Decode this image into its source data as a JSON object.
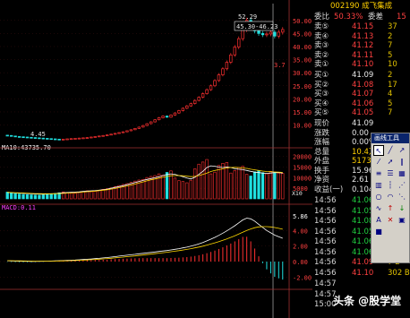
{
  "colors": {
    "up": "#ff3030",
    "down": "#20e0e0",
    "ma5": "#ffffff",
    "ma10": "#ffd700",
    "ma20": "#ff40ff",
    "dif": "#ffffff",
    "dea": "#ffd700"
  },
  "candles_panel": {
    "high_label": "52.29",
    "crosshair_box": "45.30-46.23",
    "low_label": "4.45",
    "cursor_label": "3.7",
    "axis_ticks": [
      "50.00",
      "45.00",
      "40.00",
      "35.00",
      "30.00",
      "25.00",
      "20.00",
      "15.00",
      "10.00"
    ]
  },
  "volume_panel": {
    "title": "MA10:43735.70",
    "axis_ticks": [
      "20000",
      "15000",
      "10000",
      "5000"
    ],
    "unit": "X10"
  },
  "macd_panel": {
    "title": "MACD:0.11",
    "axis_ticks": [
      "5.86",
      "4.00",
      "2.00",
      "0.00",
      "-2.00"
    ]
  },
  "chart_data": [
    {
      "type": "candlestick",
      "title": "",
      "ylim": [
        3,
        53
      ],
      "note": "daily price, approximate closes",
      "closes": [
        6.0,
        5.8,
        5.6,
        5.5,
        5.4,
        5.3,
        5.2,
        5.1,
        5.0,
        4.9,
        4.8,
        4.7,
        4.6,
        4.5,
        4.6,
        4.7,
        4.8,
        4.9,
        5.0,
        5.1,
        5.2,
        5.4,
        5.6,
        5.8,
        6.0,
        6.2,
        6.5,
        6.8,
        7.1,
        7.4,
        7.8,
        8.2,
        8.7,
        9.2,
        9.8,
        10.5,
        11.2,
        12.0,
        12.8,
        13.4,
        13.0,
        13.8,
        14.6,
        15.5,
        16.4,
        17.3,
        18.2,
        19.4,
        20.6,
        22.0,
        23.5,
        25.0,
        27.0,
        29.2,
        31.5,
        34.0,
        36.8,
        39.8,
        43.0,
        46.5,
        50.0,
        48.0,
        46.0,
        45.0,
        44.5,
        44.8,
        45.5,
        44.0,
        45.5,
        46.5
      ]
    },
    {
      "type": "bar",
      "title": "Volume",
      "ylim": [
        0,
        22000
      ],
      "values": [
        3200,
        2900,
        2500,
        2300,
        2100,
        2000,
        1900,
        1800,
        1800,
        1900,
        2100,
        2300,
        2600,
        2900,
        3300,
        3000,
        2800,
        2700,
        3100,
        3500,
        3800,
        3400,
        3600,
        4100,
        4500,
        4800,
        5200,
        5800,
        6300,
        6800,
        7200,
        7800,
        8400,
        8900,
        9200,
        10100,
        10600,
        11000,
        11800,
        11200,
        12500,
        13200,
        9800,
        8600,
        8200,
        7600,
        8800,
        14200,
        16400,
        17400,
        18600,
        11800,
        12600,
        15800,
        16800,
        17200,
        12200,
        13400,
        14800,
        15400,
        11600,
        10800,
        12800,
        13200,
        12400,
        11800,
        13000,
        12600,
        12200,
        12000
      ],
      "ma5": [
        3000,
        2900,
        2800,
        2700,
        2600,
        2500,
        2400,
        2300,
        2300,
        2200,
        2300,
        2400,
        2500,
        2700,
        2900,
        3000,
        3100,
        3200,
        3300,
        3500,
        3700,
        3800,
        3900,
        4100,
        4300,
        4600,
        5000,
        5400,
        5800,
        6200,
        6700,
        7200,
        7700,
        8200,
        8700,
        9200,
        9600,
        10000,
        10500,
        11000,
        11500,
        11800,
        11600,
        11000,
        10500,
        9800,
        9400,
        10200,
        11600,
        13000,
        14800,
        15600,
        15400,
        15000,
        14800,
        15000,
        14800,
        14200,
        14000,
        13800,
        13400,
        13000,
        12600,
        12400,
        12200,
        12000,
        12200,
        12400,
        12400,
        12200
      ],
      "ma10": [
        3100,
        3000,
        2900,
        2850,
        2800,
        2700,
        2600,
        2500,
        2450,
        2400,
        2400,
        2400,
        2450,
        2500,
        2600,
        2700,
        2800,
        2900,
        3000,
        3200,
        3400,
        3500,
        3700,
        3900,
        4100,
        4300,
        4600,
        4900,
        5300,
        5700,
        6100,
        6500,
        7000,
        7500,
        8000,
        8500,
        9000,
        9400,
        9800,
        10200,
        10600,
        10900,
        11000,
        11000,
        10900,
        10700,
        10500,
        10600,
        11000,
        11500,
        12200,
        12900,
        13400,
        13800,
        14200,
        14600,
        14800,
        14900,
        14800,
        14600,
        14400,
        14000,
        13700,
        13400,
        13100,
        12900,
        12800,
        12700,
        12600,
        12500
      ]
    },
    {
      "type": "line",
      "title": "MACD",
      "ylim": [
        -3,
        6
      ],
      "dif": [
        0.1,
        0.08,
        0.06,
        0.05,
        0.04,
        0.03,
        0.02,
        0.02,
        0.03,
        0.04,
        0.05,
        0.07,
        0.09,
        0.11,
        0.13,
        0.15,
        0.17,
        0.2,
        0.23,
        0.26,
        0.3,
        0.34,
        0.38,
        0.42,
        0.47,
        0.52,
        0.58,
        0.64,
        0.7,
        0.76,
        0.82,
        0.88,
        0.94,
        1.0,
        1.06,
        1.12,
        1.18,
        1.24,
        1.3,
        1.36,
        1.42,
        1.5,
        1.58,
        1.66,
        1.76,
        1.86,
        1.98,
        2.12,
        2.28,
        2.46,
        2.66,
        2.88,
        3.12,
        3.38,
        3.66,
        3.96,
        4.28,
        4.62,
        4.98,
        5.36,
        5.6,
        5.5,
        5.2,
        4.8,
        4.4,
        4.0,
        3.7,
        3.4,
        3.2,
        3.0
      ],
      "dea": [
        0.12,
        0.11,
        0.1,
        0.09,
        0.08,
        0.07,
        0.06,
        0.05,
        0.05,
        0.05,
        0.05,
        0.06,
        0.07,
        0.08,
        0.09,
        0.1,
        0.12,
        0.14,
        0.16,
        0.18,
        0.21,
        0.24,
        0.27,
        0.31,
        0.35,
        0.39,
        0.43,
        0.48,
        0.53,
        0.58,
        0.63,
        0.68,
        0.73,
        0.78,
        0.84,
        0.9,
        0.96,
        1.02,
        1.08,
        1.14,
        1.2,
        1.27,
        1.34,
        1.41,
        1.49,
        1.57,
        1.66,
        1.76,
        1.87,
        1.99,
        2.12,
        2.26,
        2.41,
        2.57,
        2.74,
        2.92,
        3.12,
        3.32,
        3.54,
        3.77,
        4.0,
        4.2,
        4.36,
        4.46,
        4.5,
        4.5,
        4.46,
        4.38,
        4.28,
        4.16
      ]
    }
  ],
  "quote": {
    "header_code": "002190 成飞集成",
    "wb_label": "委比",
    "wb_value": "50.33%",
    "wc_label": "委差",
    "wc_value": "15",
    "asks": [
      {
        "label": "卖⑤",
        "price": "41.15",
        "vol": "37"
      },
      {
        "label": "卖④",
        "price": "41.13",
        "vol": "2"
      },
      {
        "label": "卖③",
        "price": "41.12",
        "vol": "7"
      },
      {
        "label": "卖②",
        "price": "41.11",
        "vol": "5"
      },
      {
        "label": "卖①",
        "price": "41.10",
        "vol": "10"
      }
    ],
    "bids": [
      {
        "label": "买①",
        "price": "41.09",
        "vol": "2"
      },
      {
        "label": "买②",
        "price": "41.08",
        "vol": "17"
      },
      {
        "label": "买③",
        "price": "41.07",
        "vol": "4"
      },
      {
        "label": "买④",
        "price": "41.06",
        "vol": "5"
      },
      {
        "label": "买⑤",
        "price": "41.05",
        "vol": "7"
      }
    ],
    "stats": [
      {
        "label": "现价",
        "value": "41.09"
      },
      {
        "label": "涨跌",
        "value": "0.00"
      },
      {
        "label": "涨幅",
        "value": "0.00%"
      },
      {
        "label": "总量",
        "value": "10.4万"
      },
      {
        "label": "外盘",
        "value": "51737"
      },
      {
        "label": "换手",
        "value": "15.96%"
      },
      {
        "label": "净资",
        "value": "2.61"
      },
      {
        "label": "收益(一)",
        "value": "0.104"
      }
    ],
    "ticks": [
      {
        "time": "14:56",
        "price": "41.06",
        "vol": "10"
      },
      {
        "time": "14:56",
        "price": "41.05",
        "vol": "21"
      },
      {
        "time": "14:56",
        "price": "41.08",
        "vol": "6"
      },
      {
        "time": "14:56",
        "price": "41.05",
        "vol": "9"
      },
      {
        "time": "14:56",
        "price": "41.06",
        "vol": "17"
      },
      {
        "time": "14:56",
        "price": "41.06",
        "vol": "5"
      },
      {
        "time": "14:56",
        "price": "41.09",
        "vol": "7 B"
      },
      {
        "time": "14:56",
        "price": "41.10",
        "vol": "302 B"
      }
    ],
    "tail": [
      "14:57",
      "14:57",
      "15:00"
    ]
  },
  "tools": {
    "title": "画线工具",
    "icons": [
      "cursor-icon",
      "line-icon",
      "ray-icon",
      "segment-icon",
      "arrow-icon",
      "parallel-icon",
      "channel-icon",
      "fib-icon",
      "grid-icon",
      "bars-icon",
      "period-icon",
      "fan-icon",
      "circle-icon",
      "arc-icon",
      "speed-icon",
      "cycle-icon",
      "up-arrow-icon",
      "down-arrow-icon",
      "text-icon",
      "delete-icon",
      "lock-icon",
      "color-icon"
    ]
  },
  "watermark": "头条 @股学堂"
}
